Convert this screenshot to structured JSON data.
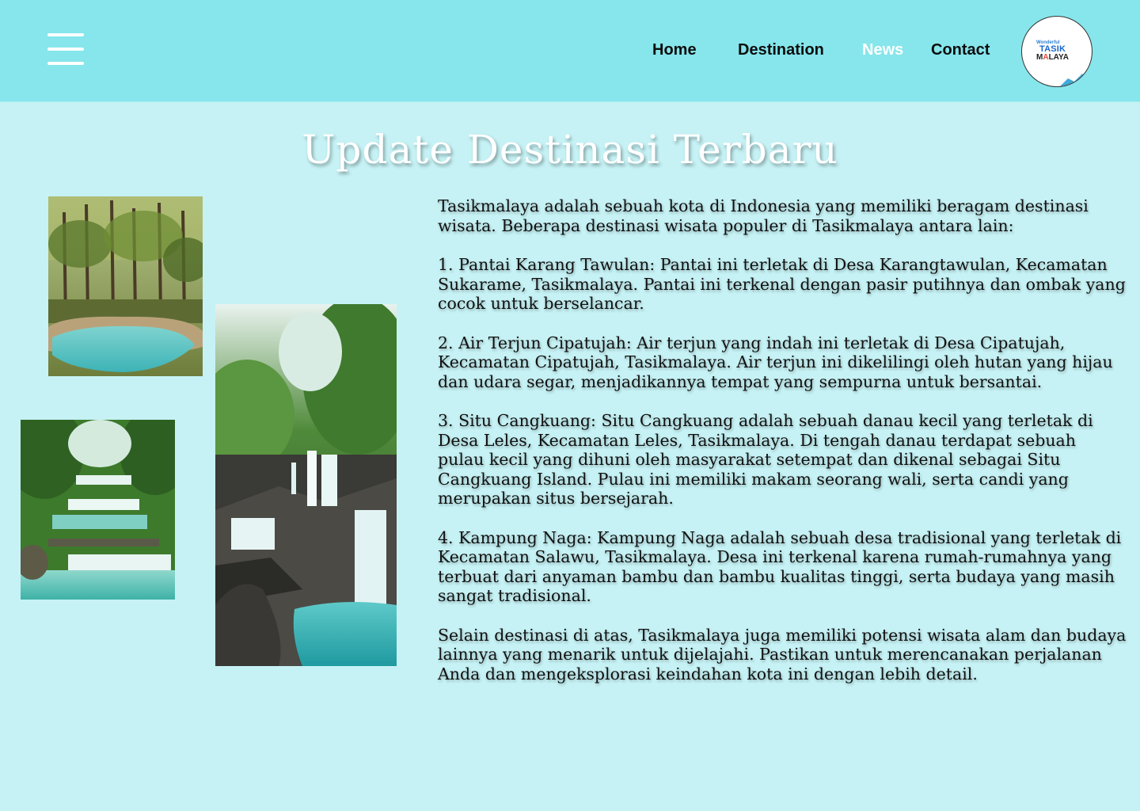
{
  "nav": {
    "links": [
      "Home",
      "Destination",
      "News",
      "Contact"
    ],
    "active": "News"
  },
  "logo": {
    "small_text": "Wonderful",
    "line1": "TASIK",
    "line2_a": "M",
    "line2_b": "A",
    "line2_c": "LAYA"
  },
  "page": {
    "title": "Update Destinasi Terbaru",
    "paragraphs": [
      "Tasikmalaya adalah sebuah kota di Indonesia yang memiliki beragam destinasi wisata. Beberapa destinasi wisata populer di Tasikmalaya antara lain:",
      "1. Pantai Karang Tawulan: Pantai ini terletak di Desa Karangtawulan, Kecamatan Sukarame, Tasikmalaya. Pantai ini terkenal dengan pasir putihnya dan ombak yang cocok untuk berselancar.",
      "2. Air Terjun Cipatujah: Air terjun yang indah ini terletak di Desa Cipatujah, Kecamatan Cipatujah, Tasikmalaya. Air terjun ini dikelilingi oleh hutan yang hijau dan udara segar, menjadikannya tempat yang sempurna untuk bersantai.",
      "3. Situ Cangkuang: Situ Cangkuang adalah sebuah danau kecil yang terletak di Desa Leles, Kecamatan Leles, Tasikmalaya. Di tengah danau terdapat sebuah pulau kecil yang dihuni oleh masyarakat setempat dan dikenal sebagai Situ Cangkuang Island. Pulau ini memiliki makam seorang wali, serta candi yang merupakan situs bersejarah.",
      "4. Kampung Naga: Kampung Naga adalah sebuah desa tradisional yang terletak di Kecamatan Salawu, Tasikmalaya. Desa ini terkenal karena rumah-rumahnya yang terbuat dari anyaman bambu dan bambu kualitas tinggi, serta budaya yang masih sangat tradisional.",
      "Selain destinasi di atas, Tasikmalaya juga memiliki potensi wisata alam dan budaya lainnya yang menarik untuk dijelajahi. Pastikan untuk merencanakan perjalanan Anda dan mengeksplorasi keindahan kota ini dengan lebih detail."
    ]
  },
  "colors": {
    "header_bg": "#86e6ec",
    "page_bg": "#c6f2f5",
    "active_link": "#ffffff",
    "link": "#0d0d0d"
  }
}
